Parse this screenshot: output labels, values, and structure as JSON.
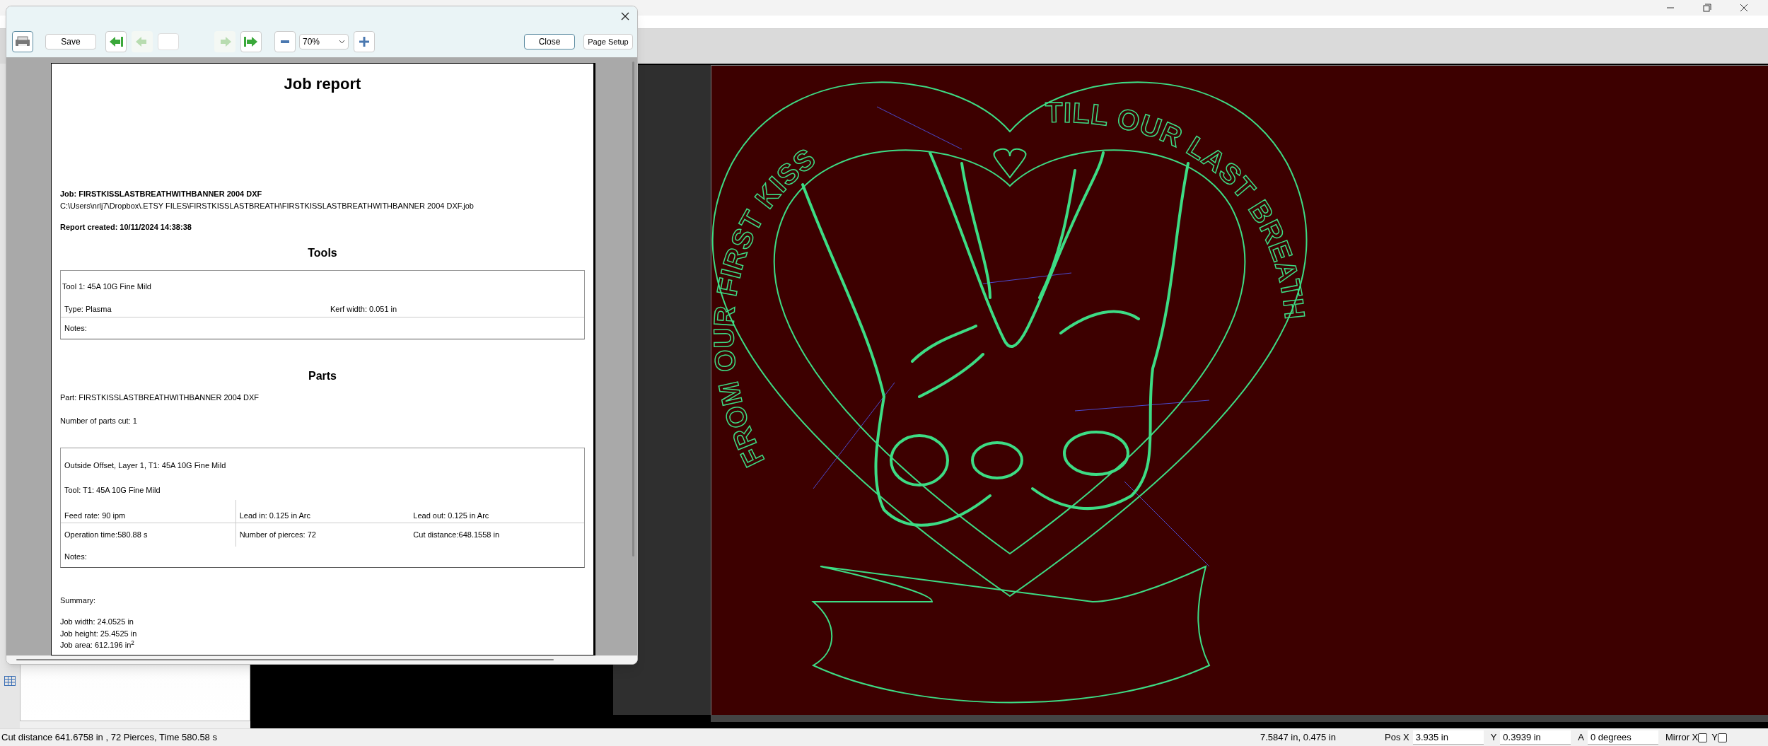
{
  "canvas": {
    "design_text": [
      "FROM OUR FIRST KISS",
      "TILL OUR LAST BREATH"
    ]
  },
  "dialog": {
    "toolbar": {
      "save": "Save",
      "nav": [
        {
          "kind": "first",
          "disabled": false
        },
        {
          "kind": "prev",
          "disabled": true
        },
        {
          "kind": "next",
          "disabled": true
        },
        {
          "kind": "last",
          "disabled": false
        }
      ],
      "zoom": "70%",
      "close": "Close",
      "page_setup": "Page Setup"
    },
    "report": {
      "title": "Job report",
      "job": "Job: FIRSTKISSLASTBREATHWITHBANNER 2004 DXF",
      "path": "C:\\Users\\nrlj7\\Dropbox\\.ETSY FILES\\FIRSTKISSLASTBREATH\\FIRSTKISSLASTBREATHWITHBANNER 2004 DXF.job",
      "created": "Report created: 10/11/2024 14:38:38",
      "tools_heading": "Tools",
      "tool": {
        "name": "Tool 1: 45A 10G Fine Mild",
        "type": "Type: Plasma",
        "kerf": "Kerf width: 0.051 in",
        "notes": "Notes:"
      },
      "parts_heading": "Parts",
      "part": "Part: FIRSTKISSLASTBREATHWITHBANNER 2004 DXF",
      "count": "Number of parts cut: 1",
      "operation": {
        "title": "Outside Offset, Layer 1, T1: 45A 10G Fine Mild",
        "tool": "Tool: T1: 45A 10G Fine Mild",
        "cells": [
          "Feed rate: 90 ipm",
          "Lead in: 0.125 in Arc",
          "Lead out: 0.125 in Arc",
          "Operation time:580.88 s",
          "Number of pierces: 72",
          "Cut distance:648.1558 in"
        ],
        "notes": "Notes:"
      },
      "summary": "Summary:",
      "lines": [
        "Job width: 24.0525 in",
        "Job height: 25.4525 in",
        "Job area: 612.196 in$^{2}$"
      ]
    }
  },
  "status_bar": {
    "summary": "Cut distance 641.6758 in , 72 Pierces, Time 580.58 s",
    "coords": "7.5847 in, 0.475 in",
    "fields": [
      {
        "label": "Pos X",
        "value": "3.935 in"
      },
      {
        "label": "Y",
        "value": "0.3939 in"
      },
      {
        "label": "A",
        "value": "0 degrees"
      }
    ],
    "mirror": [
      {
        "label": "Mirror X",
        "checked": false
      },
      {
        "label": "Y",
        "checked": false
      }
    ]
  }
}
